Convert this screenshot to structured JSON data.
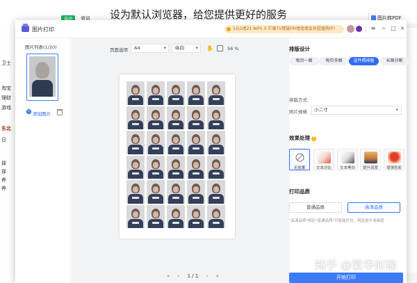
{
  "background": {
    "banner": "设为默认浏览器，给您提供更好的服务",
    "tab_green": "自动",
    "tab_label": "资讯",
    "right_label": "图片转PDF",
    "left_items": [
      "卫士",
      "淘宝",
      "理财",
      "游戏",
      "东北",
      "日",
      "择",
      "择",
      "养",
      "养"
    ]
  },
  "dialog": {
    "title": "图片打印",
    "promo": "1元1墙21 WPS X 芒果TV墙链FM墙墙墙会员超值购中!",
    "window_buttons": {
      "menu": "≡",
      "minimize": "−",
      "maximize": "□",
      "close": "×"
    }
  },
  "left_panel": {
    "title": "图片列表(1/20)",
    "add_label": "添加图片"
  },
  "preview": {
    "page_label": "页面选项",
    "paper_value": "A4",
    "orientation_value": "纵向",
    "zoom": "56 %",
    "photo_count": 30,
    "pager": {
      "first": "«",
      "prev": "‹",
      "page": "1 / 1",
      "next": "›",
      "last": "»"
    }
  },
  "right_panel": {
    "layout_title": "排版设计",
    "modes": [
      {
        "label": "每页一图",
        "active": false
      },
      {
        "label": "每页多图",
        "active": false
      },
      {
        "label": "证件照排版",
        "active": true
      },
      {
        "label": "长图分割",
        "active": false
      }
    ],
    "layout_method_label": "排版方式",
    "size_label": "照片规格",
    "size_value": "小二寸",
    "effect_title": "效果处理",
    "effects": [
      {
        "label": "无效果",
        "active": true
      },
      {
        "label": "文本对比",
        "active": false
      },
      {
        "label": "文本黑白",
        "active": false
      },
      {
        "label": "提升亮度",
        "active": false
      },
      {
        "label": "增强色彩",
        "active": false
      }
    ],
    "quality_title": "打印品质",
    "quality_options": [
      {
        "label": "普通品质",
        "active": false
      },
      {
        "label": "高清品质",
        "active": true
      }
    ],
    "quality_note": "\"高清品质\"相比\"普通品质\"可智能优化，明显提升清晰度",
    "start_label": "开始打印"
  },
  "watermark": "知乎 @繁华似锦"
}
